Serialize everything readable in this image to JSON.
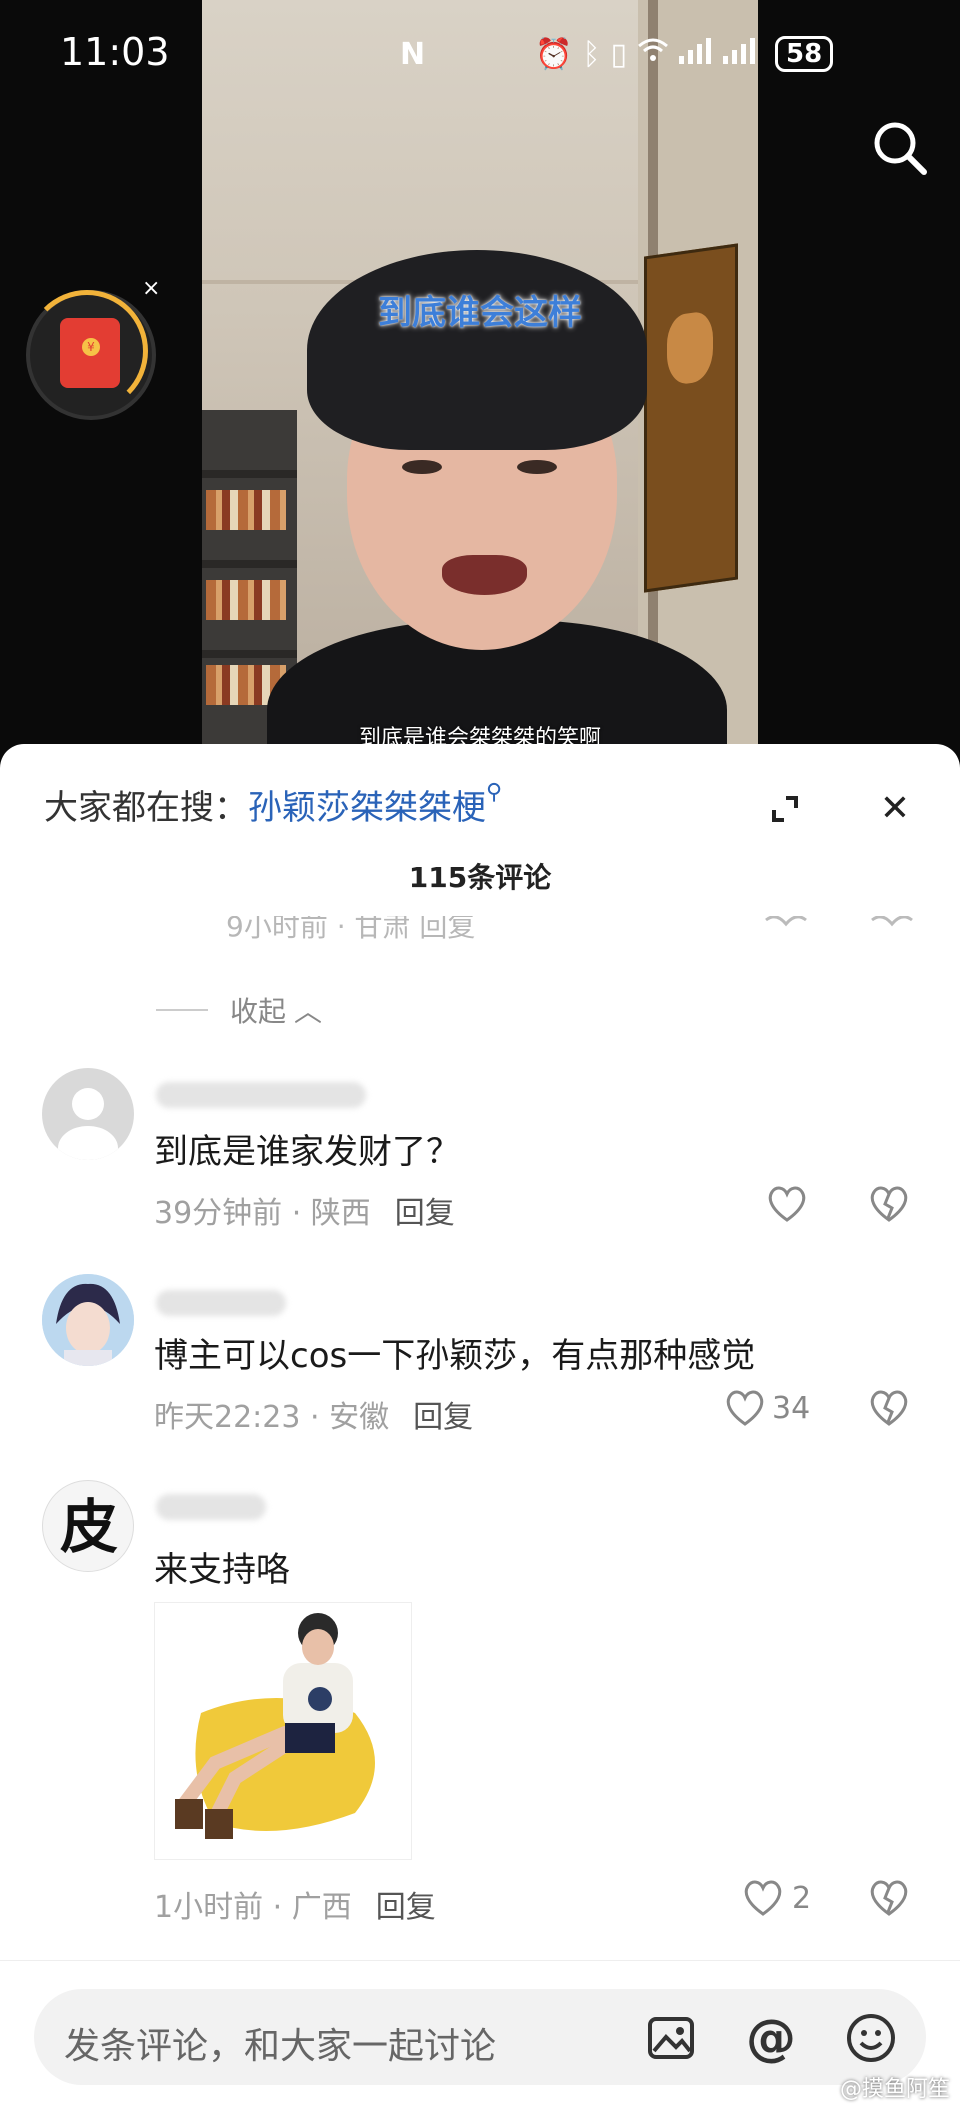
{
  "status_bar": {
    "time": "11:03",
    "nfc": "N",
    "battery": "58"
  },
  "video": {
    "caption_top": "到底谁会这样",
    "caption_bottom": "到底是谁会桀桀桀的笑啊"
  },
  "panel": {
    "trending_prefix": "大家都在搜：",
    "trending_query": "孙颖莎桀桀桀梗",
    "comment_count": "115条评论",
    "ghost_meta": "9小时前 · 甘肃   回复",
    "collapse_label": "收起"
  },
  "comments": [
    {
      "text": "到底是谁家发财了？",
      "time": "39分钟前",
      "location": "陕西",
      "reply": "回复",
      "likes": ""
    },
    {
      "text": "博主可以cos一下孙颖莎，有点那种感觉",
      "time": "昨天22:23",
      "location": "安徽",
      "reply": "回复",
      "likes": "34"
    },
    {
      "avatar_char": "皮",
      "text": "来支持咯",
      "time": "1小时前",
      "location": "广西",
      "reply": "回复",
      "likes": "2"
    }
  ],
  "input": {
    "placeholder": "发条评论，和大家一起讨论"
  },
  "watermark": "@摸鱼阿笙",
  "icons": {
    "search": "search-icon",
    "expand": "expand-icon",
    "close": "close-icon",
    "like": "heart-icon",
    "dislike": "broken-heart-icon",
    "image": "image-icon",
    "mention": "at-icon",
    "emoji": "emoji-icon"
  }
}
